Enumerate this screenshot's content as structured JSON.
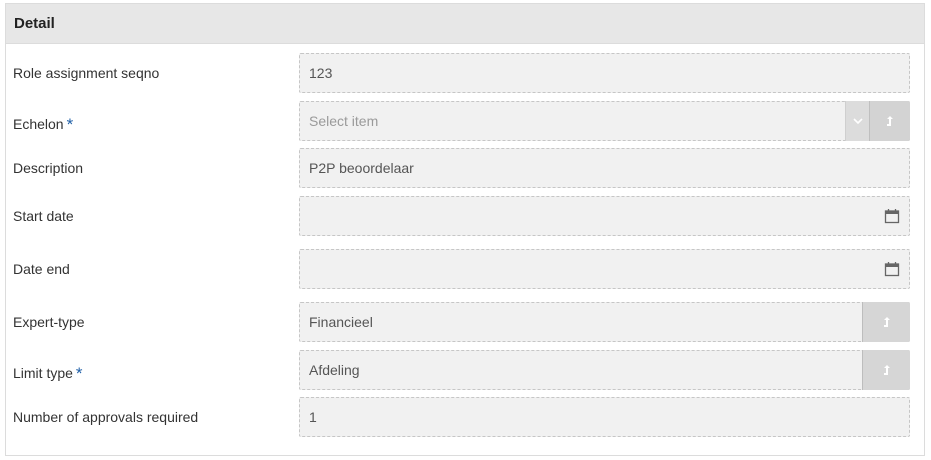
{
  "panel": {
    "title": "Detail"
  },
  "fields": {
    "seqno": {
      "label": "Role assignment seqno",
      "value": "123"
    },
    "echelon": {
      "label": "Echelon",
      "required_mark": "*",
      "placeholder": "Select item"
    },
    "description": {
      "label": "Description",
      "value": "P2P beoordelaar"
    },
    "start_date": {
      "label": "Start date",
      "value": ""
    },
    "date_end": {
      "label": "Date end",
      "value": ""
    },
    "expert_type": {
      "label": "Expert-type",
      "value": "Financieel"
    },
    "limit_type": {
      "label": "Limit type",
      "required_mark": "*",
      "value": "Afdeling"
    },
    "approvals": {
      "label": "Number of approvals required",
      "value": "1"
    }
  },
  "icons": {
    "calendar": "calendar-icon",
    "chevron": "chevron-down-icon",
    "lookup": "lookup-arrow-icon"
  },
  "colors": {
    "required": "#1f5fa7",
    "field_bg": "#f1f1f1",
    "header_bg": "#e7e7e7"
  }
}
